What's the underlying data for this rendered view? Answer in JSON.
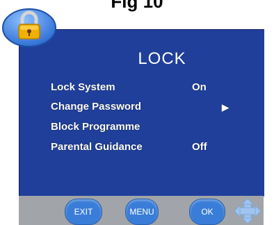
{
  "figure_label": "Fig 10",
  "osd": {
    "title": "LOCK",
    "items": [
      {
        "label": "Lock System",
        "value": "On",
        "arrow": ""
      },
      {
        "label": "Change Password",
        "value": "",
        "arrow": "▶"
      },
      {
        "label": "Block Programme",
        "value": "",
        "arrow": ""
      },
      {
        "label": "Parental Guidance",
        "value": "Off",
        "arrow": ""
      }
    ]
  },
  "footer": {
    "exit_label": "EXIT",
    "menu_label": "MENU",
    "ok_label": "OK"
  },
  "icons": {
    "lock": "padlock-icon",
    "navigation": "dpad-arrows-icon"
  },
  "colors": {
    "panel": "#1f3f9a",
    "button": "#3a7dd8",
    "footer": "#a1a4a8",
    "lock_bg": "#2f6fd3",
    "lock_gold": "#f0b000"
  }
}
